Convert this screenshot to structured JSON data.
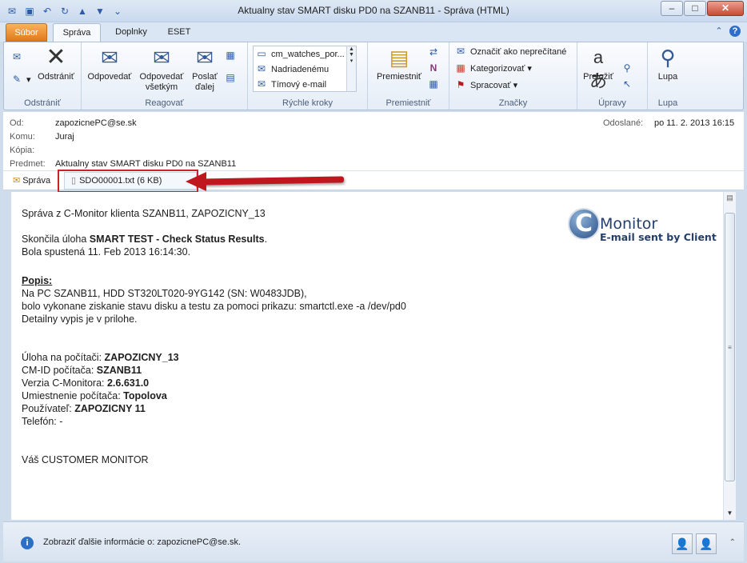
{
  "window": {
    "title": "Aktualny stav SMART disku PD0 na SZANB11  -  Správa (HTML)",
    "quick_access": [
      "mail-icon",
      "save-icon",
      "undo-icon",
      "redo-icon",
      "up-icon",
      "down-icon",
      "customize-icon"
    ],
    "buttons": {
      "minimize": "–",
      "maximize": "□",
      "close": "✕"
    }
  },
  "tabs": [
    {
      "label": "Súbor",
      "active": false
    },
    {
      "label": "Správa",
      "active": true
    },
    {
      "label": "Doplnky",
      "active": false
    },
    {
      "label": "ESET",
      "active": false
    }
  ],
  "ribbon": {
    "delete_group": {
      "label": "Odstrániť",
      "delete_button": "Odstrániť"
    },
    "respond_group": {
      "label": "Reagovať",
      "reply": "Odpovedať",
      "reply_all_1": "Odpovedať",
      "reply_all_2": "všetkým",
      "forward_1": "Poslať",
      "forward_2": "ďalej"
    },
    "quick_steps": {
      "label": "Rýchle kroky",
      "items": [
        "cm_watches_por...",
        "Nadriadenému",
        "Tímový e-mail"
      ]
    },
    "move_group": {
      "label": "Premiestniť",
      "move_button": "Premiestniť"
    },
    "tags_group": {
      "label": "Značky",
      "unread": "Označiť ako neprečítané",
      "categorize": "Kategorizovať",
      "followup": "Spracovať"
    },
    "editing_group": {
      "label": "Úpravy",
      "translate": "Preložiť"
    },
    "zoom_group": {
      "label": "Lupa",
      "zoom": "Lupa"
    }
  },
  "header": {
    "from_label": "Od:",
    "from": "zapozicnePC@se.sk",
    "to_label": "Komu:",
    "to": "Juraj",
    "cc_label": "Kópia:",
    "cc": "",
    "subject_label": "Predmet:",
    "subject": "Aktualny stav SMART disku PD0 na SZANB11",
    "sent_label": "Odoslané:",
    "sent": "po 11. 2. 2013 16:15"
  },
  "attachments": {
    "message_tab": "Správa",
    "file": "SDO00001.txt (6 KB)"
  },
  "body": {
    "intro": "Správa z C-Monitor klienta SZANB11, ZAPOZICNY_13",
    "task_prefix": "Skončila úloha ",
    "task_name": "SMART TEST - Check Status Results",
    "task_suffix": ".",
    "started": "Bola spustená 11. Feb 2013 16:14:30.",
    "popis_label": "Popis:",
    "popis_1": "Na PC SZANB11, HDD ST320LT020-9YG142 (SN: W0483JDB),",
    "popis_2": "bolo vykonane ziskanie stavu disku a testu za pomoci prikazu: smartctl.exe -a /dev/pd0",
    "popis_3": "Detailny vypis je v prilohe.",
    "task_label": "Úloha na počítači: ",
    "task_value": "ZAPOZICNY_13",
    "cmid_label": "CM-ID počítača: ",
    "cmid_value": "SZANB11",
    "version_label": "Verzia C-Monitora: ",
    "version_value": "2.6.631.0",
    "location_label": "Umiestnenie počítača: ",
    "location_value": "Topolova",
    "user_label": "Používateľ: ",
    "user_value": "ZAPOZICNY 11",
    "phone_label": "Telefón: ",
    "phone_value": "-",
    "signature": "Váš CUSTOMER MONITOR",
    "logo_c": "C",
    "logo_text": "Monitor",
    "logo_sub": "E-mail sent by Client"
  },
  "footer": {
    "info": "Zobraziť ďalšie informácie o: zapozicnePC@se.sk."
  }
}
